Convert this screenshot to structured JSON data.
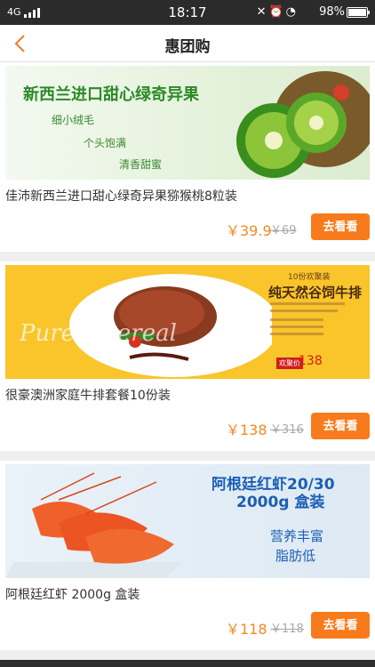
{
  "status_bar": {
    "network": "4G",
    "time": "18:17",
    "battery_percent": "98%"
  },
  "nav": {
    "title": "惠团购"
  },
  "products": [
    {
      "name": "佳沛新西兰进口甜心绿奇异果猕猴桃8粒装",
      "price": "￥39.9",
      "original_price": "￥69",
      "button": "去看看",
      "banner": {
        "headline": "新西兰进口甜心绿奇异果",
        "line1": "细小绒毛",
        "line2": "个头饱满",
        "line3": "清香甜蜜"
      }
    },
    {
      "name": "很豪澳洲家庭牛排套餐10份装",
      "price": "￥138",
      "original_price": "￥316",
      "button": "去看看",
      "banner": {
        "script": "Pure n cereal",
        "tagline": "10份欢聚装",
        "headline": "纯天然谷饲牛排",
        "tag_label": "欢聚价",
        "tag_price": "138"
      }
    },
    {
      "name": "阿根廷红虾 2000g 盒装",
      "price": "￥118",
      "original_price": "￥118",
      "button": "去看看",
      "banner": {
        "headline1": "阿根廷红虾20/30",
        "headline2": "2000g 盒装",
        "feature1": "营养丰富",
        "feature2": "脂肪低"
      }
    }
  ],
  "colors": {
    "accent": "#f77b1c",
    "price": "#f08a24"
  }
}
